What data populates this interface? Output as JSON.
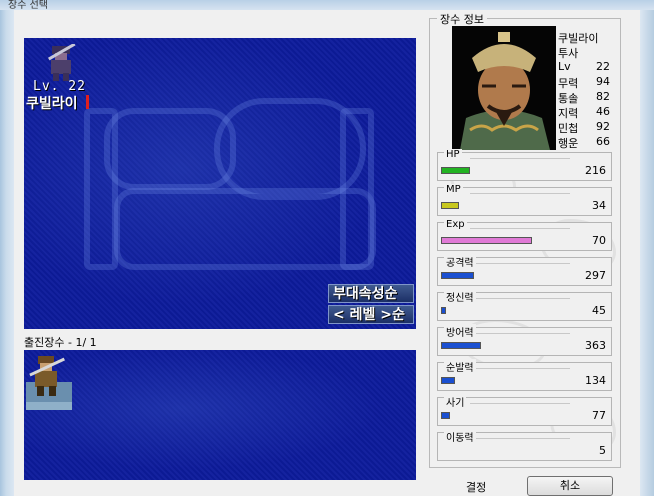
{
  "window": {
    "title": "장수 선택"
  },
  "map": {
    "unit": {
      "level_text": "Lv.  22",
      "name": "쿠빌라이"
    },
    "sort_buttons": [
      "부대속성순",
      "< 레벨 >순"
    ]
  },
  "deploy": {
    "label": "출진장수  -  1/ 1"
  },
  "info": {
    "group_title": "장수 정보",
    "general_name": "쿠빌라이",
    "general_class": "투사",
    "stats": [
      {
        "label": "Lv",
        "value": "22"
      },
      {
        "label": "무력",
        "value": "94"
      },
      {
        "label": "통솔",
        "value": "82"
      },
      {
        "label": "지력",
        "value": "46"
      },
      {
        "label": "민첩",
        "value": "92"
      },
      {
        "label": "행운",
        "value": "66"
      }
    ],
    "bars": [
      {
        "label": "HP",
        "value": "216",
        "fill": 0.22,
        "color": "#22b322"
      },
      {
        "label": "MP",
        "value": "34",
        "fill": 0.14,
        "color": "#c8c81e"
      },
      {
        "label": "Exp",
        "value": "70",
        "fill": 0.7,
        "color": "#e07ad6"
      },
      {
        "label": "공격력",
        "value": "297",
        "fill": 0.25,
        "color": "#1a4fd0"
      },
      {
        "label": "정신력",
        "value": "45",
        "fill": 0.04,
        "color": "#1a4fd0"
      },
      {
        "label": "방어력",
        "value": "363",
        "fill": 0.31,
        "color": "#1a4fd0"
      },
      {
        "label": "순발력",
        "value": "134",
        "fill": 0.11,
        "color": "#1a4fd0"
      },
      {
        "label": "사기",
        "value": "77",
        "fill": 0.07,
        "color": "#1a4fd0"
      },
      {
        "label": "이동력",
        "value": "5",
        "fill": 0,
        "color": "#1a4fd0"
      }
    ]
  },
  "buttons": {
    "confirm": "결정",
    "cancel": "취소"
  }
}
